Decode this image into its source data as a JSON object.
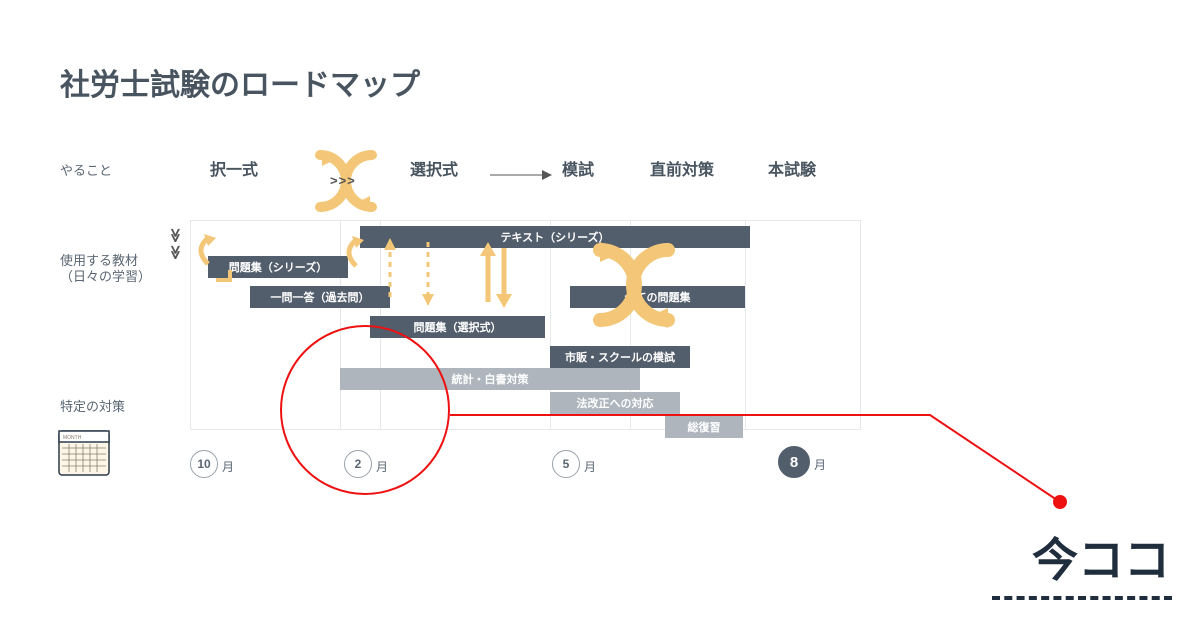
{
  "title": "社労士試験のロードマップ",
  "row_labels": {
    "todo": "やること",
    "materials_l1": "使用する教材",
    "materials_l2": "（日々の学習）",
    "specific": "特定の対策"
  },
  "phases": {
    "takuichi": "択一式",
    "sentaku": "選択式",
    "moshi": "模試",
    "chokuzen": "直前対策",
    "honshiken": "本試験"
  },
  "bars": {
    "text_series": "テキスト（シリーズ）",
    "mondaishu_series": "問題集（シリーズ）",
    "ichimon": "一問一答（過去問）",
    "mondaishu_sentaku": "問題集（選択式）",
    "all_mondaishu": "全ての問題集",
    "shihan_moshi": "市販・スクールの模試",
    "toukei": "統計・白書対策",
    "houkaisei": "法改正への対応",
    "moushuu": "総復習"
  },
  "months": {
    "m10": "10",
    "m2": "2",
    "m5": "5",
    "m8": "8",
    "suffix": "月"
  },
  "calendar_header": "MONTH",
  "now_here": "今ココ",
  "arrows": ">>>",
  "down_chev": "≫"
}
